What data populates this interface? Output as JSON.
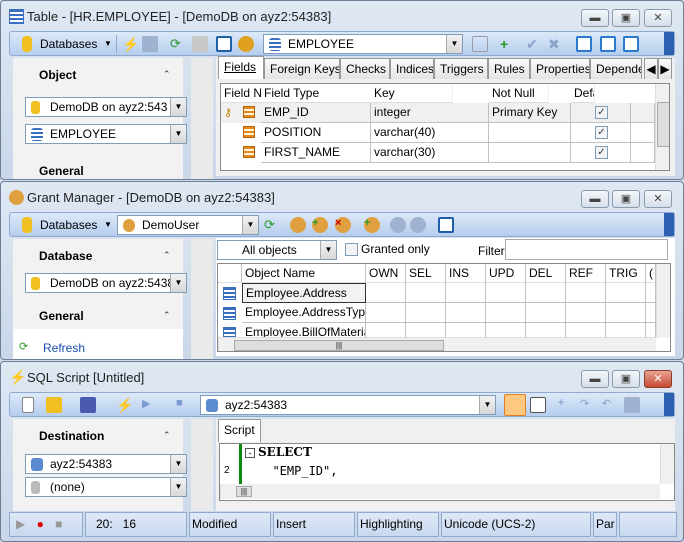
{
  "table_window": {
    "title": "Table - [HR.EMPLOYEE] - [DemoDB on ayz2:54383]",
    "toolbar": {
      "databases": "Databases",
      "object_combo": "EMPLOYEE"
    },
    "left": {
      "section1": "Object",
      "database_combo": "DemoDB on ayz2:543",
      "object_combo": "EMPLOYEE",
      "section2": "General"
    },
    "tabs": [
      "Fields",
      "Foreign Keys",
      "Checks",
      "Indices",
      "Triggers",
      "Rules",
      "Properties",
      "Depende"
    ],
    "columns": [
      "Field Name",
      "Field Type",
      "Key",
      "Not Null",
      "Defa"
    ],
    "rows": [
      {
        "name": "EMP_ID",
        "type": "integer",
        "key": "Primary Key",
        "not_null": true
      },
      {
        "name": "POSITION",
        "type": "varchar(40)",
        "key": "",
        "not_null": true
      },
      {
        "name": "FIRST_NAME",
        "type": "varchar(30)",
        "key": "",
        "not_null": true
      }
    ]
  },
  "grant_window": {
    "title": "Grant Manager - [DemoDB on ayz2:54383]",
    "toolbar": {
      "databases": "Databases",
      "user_combo": "DemoUser"
    },
    "left": {
      "section1": "Database",
      "database_combo": "DemoDB on ayz2:5438",
      "section2": "General",
      "refresh": "Refresh"
    },
    "filter_bar": {
      "objects_combo": "All objects",
      "granted_only": "Granted only",
      "granted_checked": false,
      "filter_label": "Filter",
      "filter_value": ""
    },
    "columns": [
      "Object Name",
      "OWN",
      "SEL",
      "INS",
      "UPD",
      "DEL",
      "REF",
      "TRIG",
      "("
    ],
    "rows": [
      "Employee.Address",
      "Employee.AddressType",
      "Employee.BillOfMaterials"
    ]
  },
  "sql_window": {
    "title": "SQL Script [Untitled]",
    "toolbar": {
      "server_combo": "ayz2:54383"
    },
    "left": {
      "section1": "Destination",
      "server_combo": "ayz2:54383",
      "database_combo": "(none)"
    },
    "tab": "Script",
    "editor": {
      "lines": [
        {
          "num": "",
          "text": "SELECT"
        },
        {
          "num": "2",
          "text": "  \"EMP_ID\","
        }
      ]
    },
    "status": {
      "position": "20:   16",
      "modified": "Modified",
      "mode": "Insert",
      "highlighting": "Highlighting",
      "encoding": "Unicode (UCS-2)",
      "par": "Par"
    }
  },
  "colors": {
    "toolbar": "#b5cdee",
    "close_red": "#c64b32",
    "record": "#e00000"
  }
}
